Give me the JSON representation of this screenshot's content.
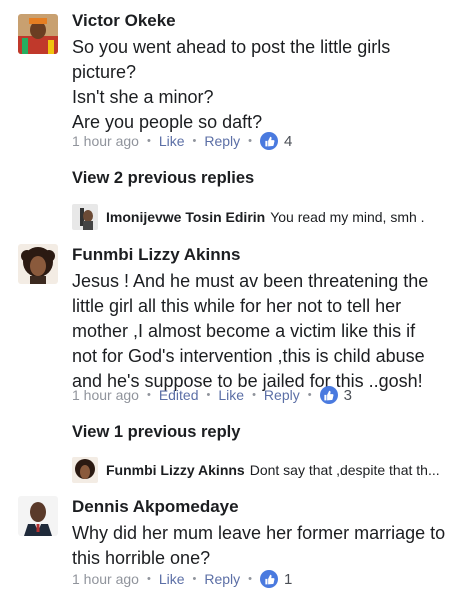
{
  "comments": [
    {
      "author": "Victor Okeke",
      "lines": [
        "So you went ahead to post the little girls",
        "picture?",
        "Isn't she a minor?",
        "Are you people so daft?"
      ],
      "time": "1 hour ago",
      "edited": "",
      "like": "Like",
      "reply": "Reply",
      "reactions": "4"
    },
    {
      "author": "Funmbi Lizzy Akinns",
      "lines": [
        "Jesus ! And he must av been threatening the",
        "little girl all this while for her not to tell her",
        "mother ,I almost become a victim like this if",
        "not for God's intervention ,this is child abuse",
        "and he's suppose to be jailed for this ..gosh!"
      ],
      "time": "1 hour ago",
      "edited": "Edited",
      "like": "Like",
      "reply": "Reply",
      "reactions": "3"
    },
    {
      "author": "Dennis Akpomedaye",
      "lines": [
        "Why did her mum leave her former marriage to",
        "this horrible one?"
      ],
      "time": "1 hour ago",
      "edited": "",
      "like": "Like",
      "reply": "Reply",
      "reactions": "1"
    }
  ],
  "view_replies": [
    "View 2 previous replies",
    "View 1 previous reply"
  ],
  "replies": [
    {
      "author": "Imonijevwe Tosin Edirin",
      "text": "You read my mind, smh ."
    },
    {
      "author": "Funmbi Lizzy Akinns",
      "text": "Dont say that ,despite that th..."
    }
  ],
  "icons": {
    "like_badge": "thumbs-up-icon",
    "badge_color": "#4a7adf"
  }
}
